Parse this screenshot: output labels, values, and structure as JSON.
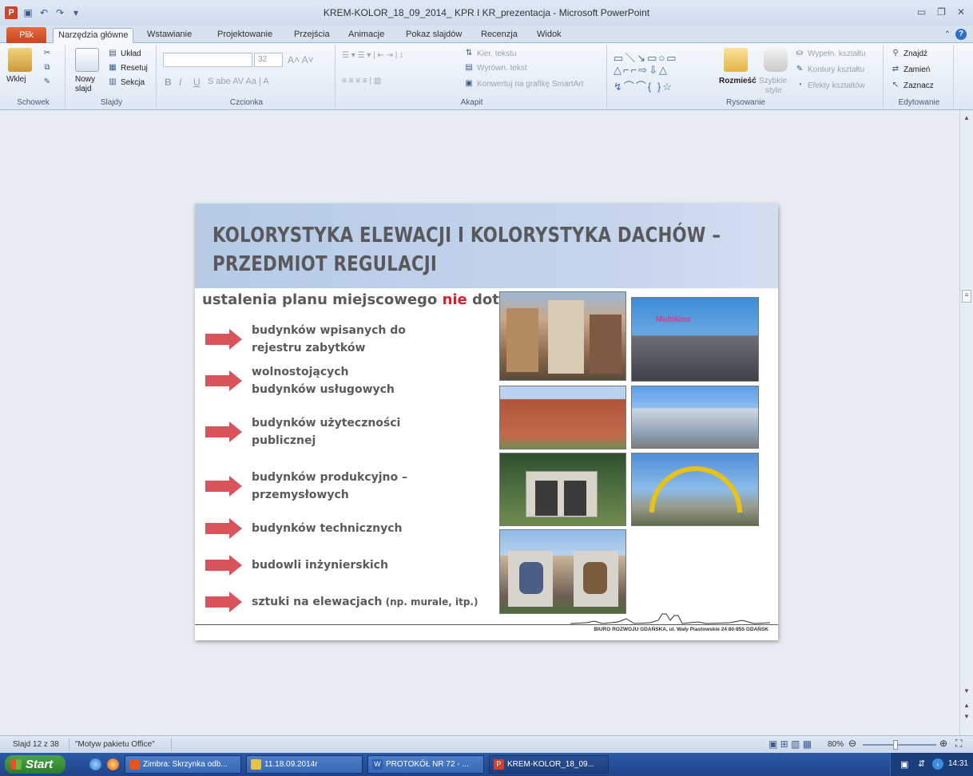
{
  "window": {
    "title": "KREM-KOLOR_18_09_2014_ KPR I KR_prezentacja  -  Microsoft PowerPoint"
  },
  "tabs": {
    "file": "Plik",
    "items": [
      "Narzędzia główne",
      "Wstawianie",
      "Projektowanie",
      "Przejścia",
      "Animacje",
      "Pokaz slajdów",
      "Recenzja",
      "Widok"
    ],
    "active_index": 0
  },
  "ribbon": {
    "clipboard": {
      "label": "Schowek",
      "paste": "Wklej"
    },
    "slides": {
      "label": "Slajdy",
      "new_slide_1": "Nowy",
      "new_slide_2": "slajd",
      "layout": "Układ",
      "reset": "Resetuj",
      "section": "Sekcja"
    },
    "font": {
      "label": "Czcionka",
      "size": "32"
    },
    "paragraph": {
      "label": "Akapit",
      "text_direction": "Kier. tekstu",
      "align_text": "Wyrówn. tekst",
      "smartart": "Konwertuj na grafikę SmartArt"
    },
    "drawing": {
      "label": "Rysowanie",
      "arrange": "Rozmieść",
      "quick_styles_1": "Szybkie",
      "quick_styles_2": "style",
      "shape_fill": "Wypełn. kształtu",
      "shape_outline": "Kontury kształtu",
      "shape_effects": "Efekty kształtów"
    },
    "editing": {
      "label": "Edytowanie",
      "find": "Znajdź",
      "replace": "Zamień",
      "select": "Zaznacz"
    }
  },
  "slide": {
    "title_line1": "KOLORYSTYKA ELEWACJI I KOLORYSTYKA DACHÓW –",
    "title_line2": "PRZEDMIOT REGULACJI",
    "subtitle_before": "ustalenia planu miejscowego ",
    "subtitle_highlight": "nie",
    "subtitle_after": " dotyczą:",
    "bullets": [
      {
        "line1": "budynków wpisanych do",
        "line2": "rejestru zabytków"
      },
      {
        "line1": "wolnostojących",
        "line2": "budynków usługowych"
      },
      {
        "line1": "budynków użyteczności",
        "line2": "publicznej"
      },
      {
        "line1": "budynków produkcyjno –",
        "line2": "przemysłowych"
      },
      {
        "line1": "budynków technicznych",
        "line2": ""
      },
      {
        "line1": "budowli inżynierskich",
        "line2": ""
      },
      {
        "line1": "sztuki na elewacjach",
        "note": " (np. murale, itp.)"
      }
    ],
    "photo_sign": "Multikino",
    "footer": "BIURO ROZWOJU GDAŃSKA, ul. Wały Piastowskie 24  80-855 GDAŃSK"
  },
  "status": {
    "slide_counter": "Slajd 12 z 38",
    "theme": "\"Motyw pakietu Office\"",
    "zoom": "80%"
  },
  "taskbar": {
    "start": "Start",
    "buttons": [
      "Zimbra: Skrzynka odb...",
      "11.18.09.2014r",
      "PROTOKÓŁ NR  72 - ...",
      "KREM-KOLOR_18_09..."
    ],
    "clock": "14:31"
  }
}
